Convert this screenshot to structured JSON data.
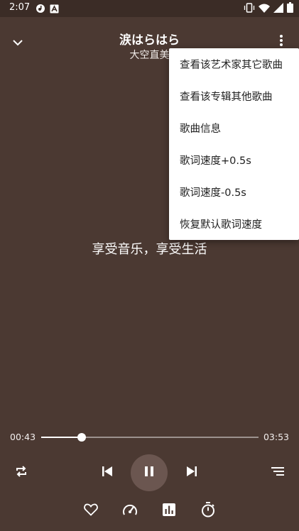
{
  "status": {
    "time": "2:07"
  },
  "header": {
    "title": "涙はらはら",
    "subtitle": "大空直美"
  },
  "lyric": {
    "current_line": "享受音乐，享受生活"
  },
  "menu": {
    "items": [
      {
        "label": "查看该艺术家其它歌曲"
      },
      {
        "label": "查看该专辑其他歌曲"
      },
      {
        "label": "歌曲信息"
      },
      {
        "label": "歌词速度+0.5s"
      },
      {
        "label": "歌词速度-0.5s"
      },
      {
        "label": "恢复默认歌词速度"
      }
    ]
  },
  "player": {
    "elapsed": "00:43",
    "duration": "03:53",
    "progress_fraction": 0.185
  },
  "icons": {
    "collapse": "chevron-down-icon",
    "more": "more-vert-icon",
    "repeat": "repeat-icon",
    "previous": "skip-previous-icon",
    "pause": "pause-icon",
    "next": "skip-next-icon",
    "playlist": "queue-list-icon",
    "favorite": "heart-icon",
    "speed": "speedometer-icon",
    "equalizer": "equalizer-icon",
    "timer": "timer-icon"
  }
}
